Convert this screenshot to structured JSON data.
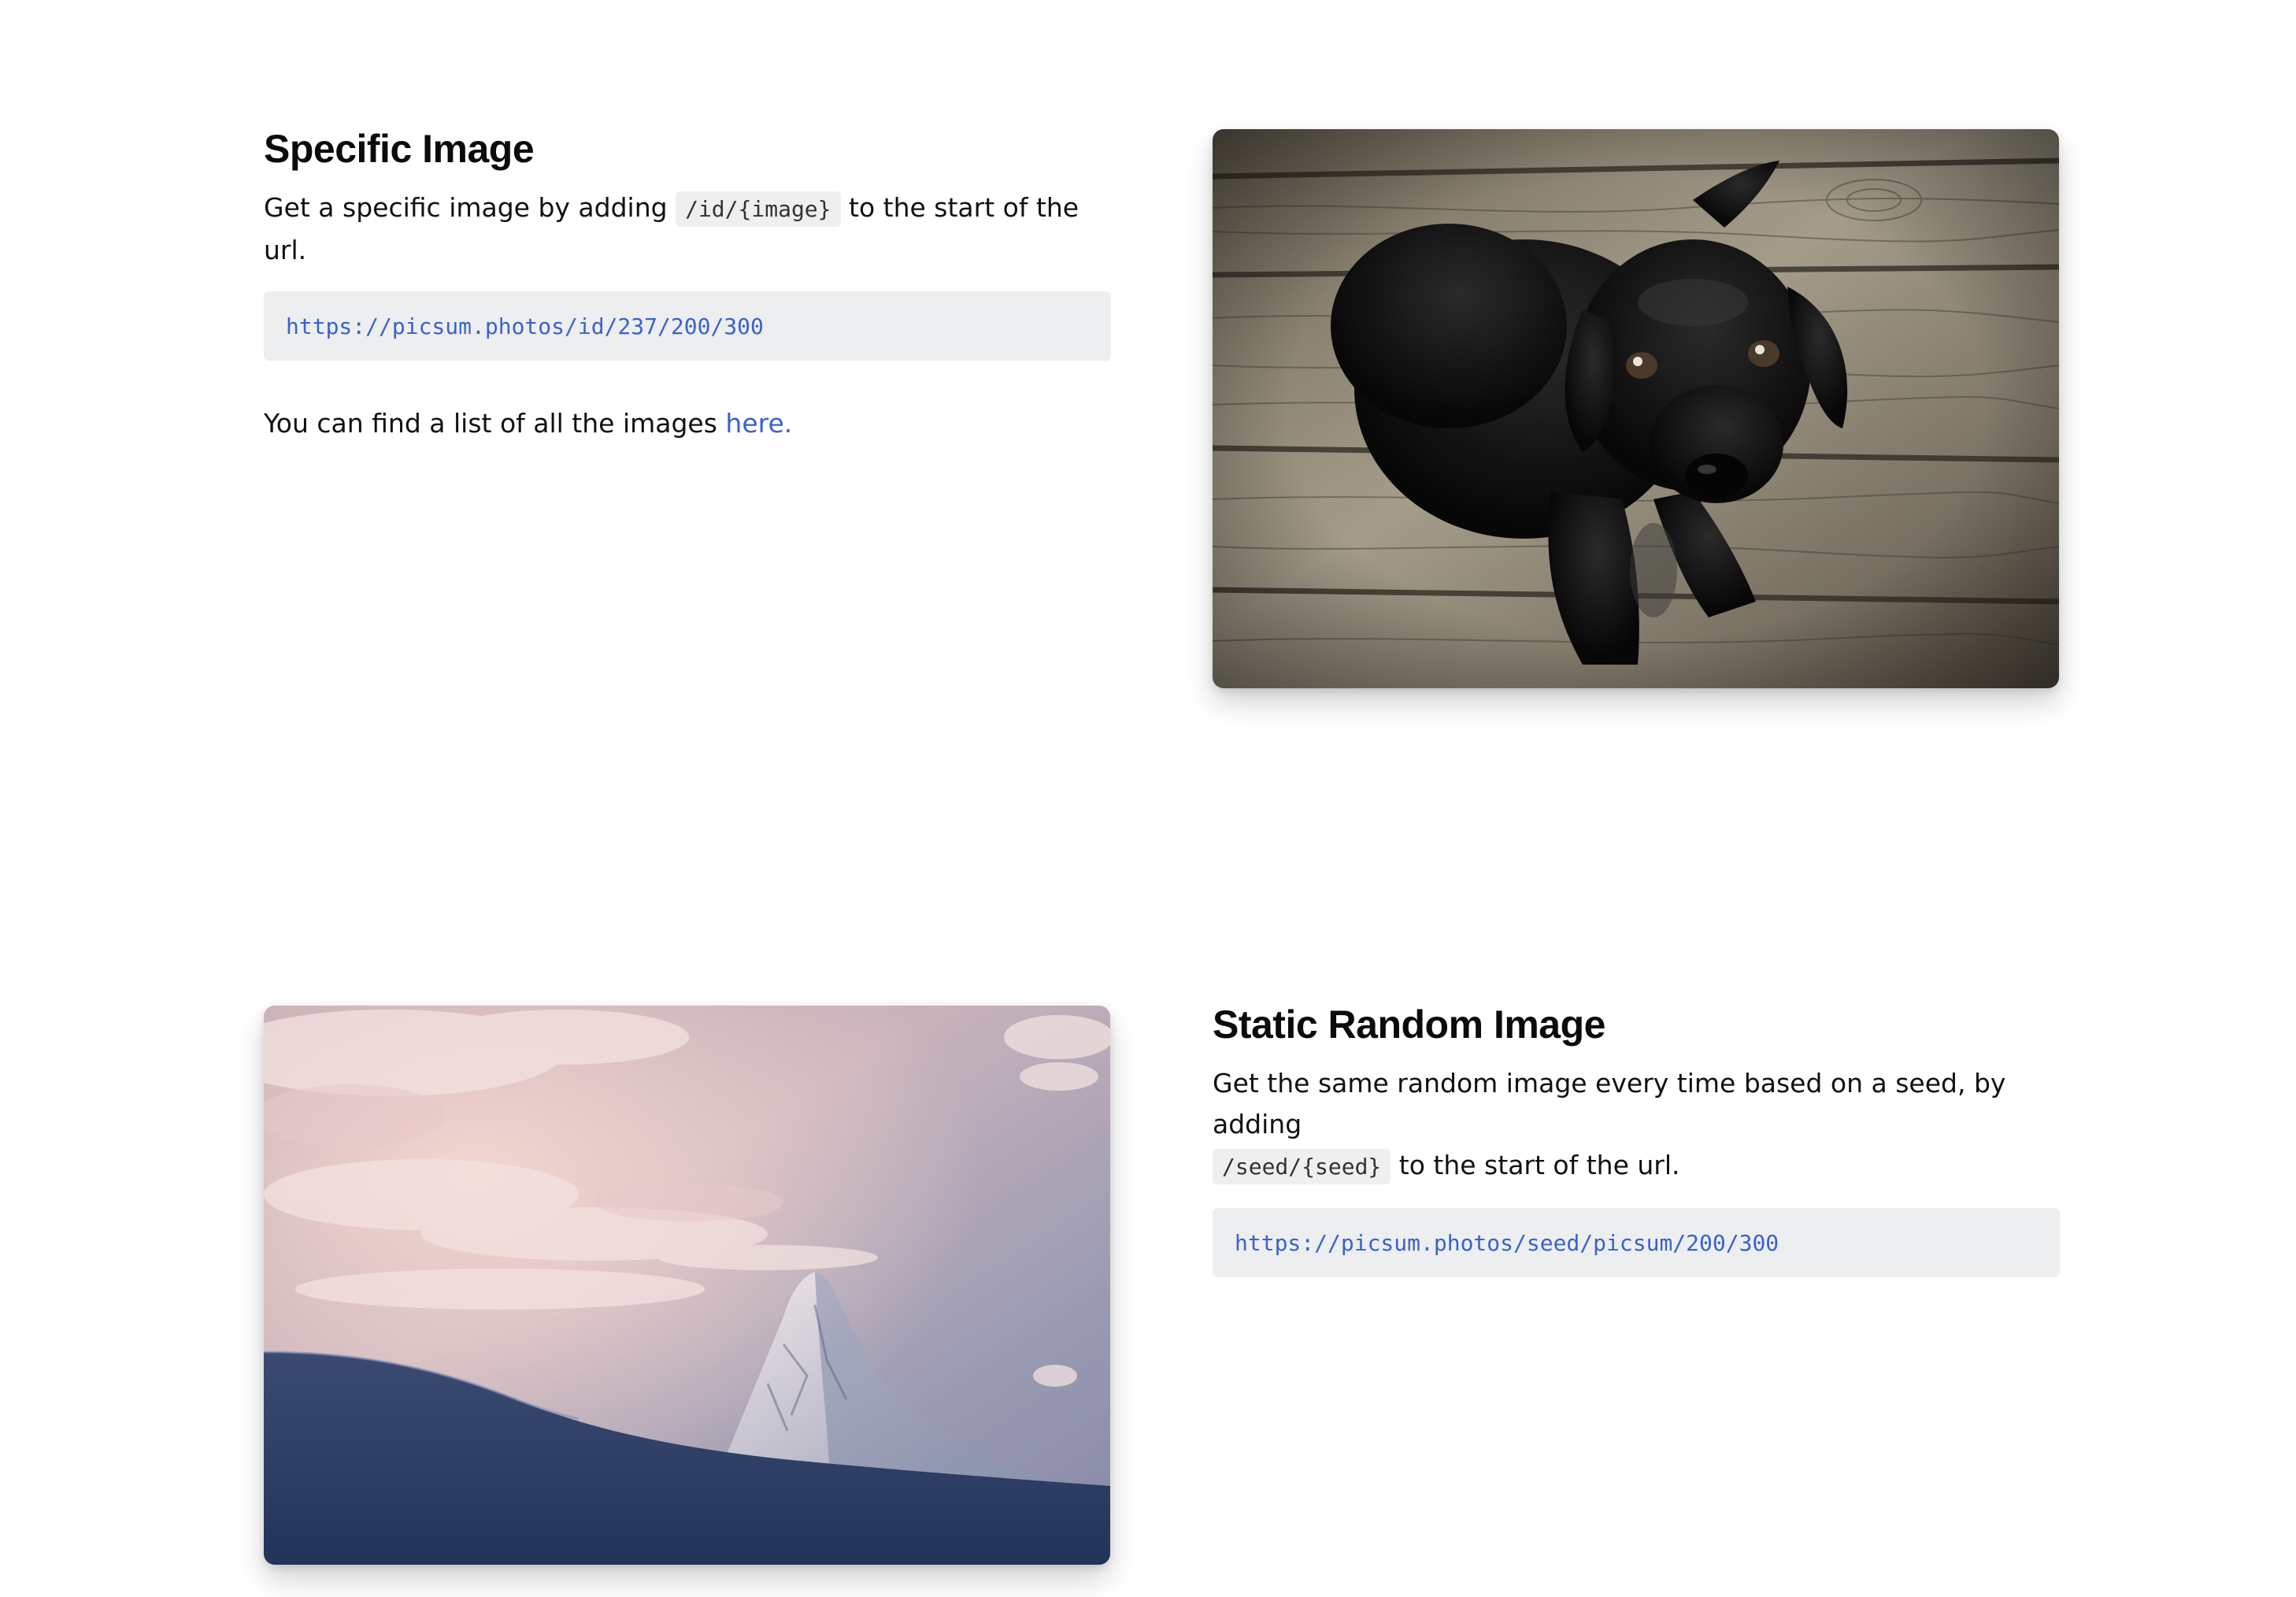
{
  "specific": {
    "title": "Specific Image",
    "desc_before": "Get a specific image by adding",
    "code": "/id/{image}",
    "desc_after": "to the start of the url.",
    "url": "https://picsum.photos/id/237/200/300",
    "list_text": "You can find a list of all the images",
    "list_link": "here."
  },
  "static_random": {
    "title": "Static Random Image",
    "desc_before": "Get the same random image every time based on a seed, by adding",
    "code": "/seed/{seed}",
    "desc_after": "to the start of the url.",
    "url": "https://picsum.photos/seed/picsum/200/300"
  },
  "images": {
    "dog": "black puppy on wooden floor",
    "mountain": "snowy mountain peak at sunset"
  }
}
